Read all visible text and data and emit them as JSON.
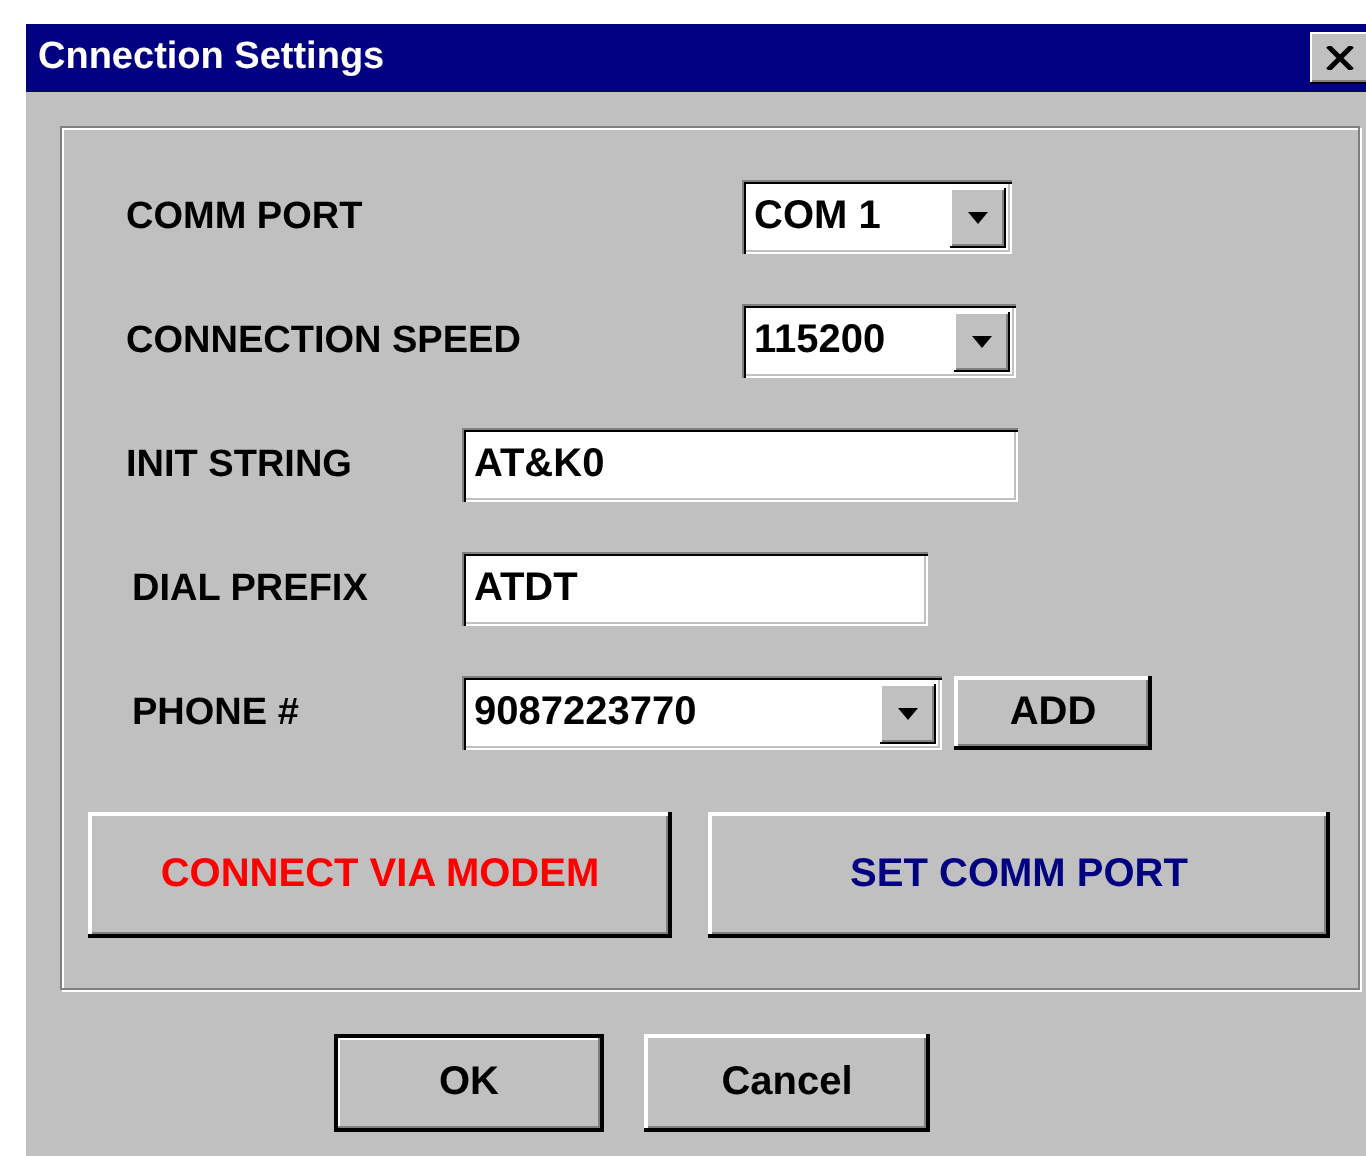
{
  "window": {
    "title": "Cnnection Settings"
  },
  "fields": [
    {
      "kind": "dropdown",
      "label": "COMM PORT",
      "value": "COM 1"
    },
    {
      "kind": "dropdown",
      "label": "CONNECTION SPEED",
      "value": "115200"
    },
    {
      "kind": "text",
      "label": "INIT STRING",
      "value": "AT&K0"
    },
    {
      "kind": "text",
      "label": "DIAL PREFIX",
      "value": "ATDT"
    },
    {
      "kind": "dropdown",
      "label": "PHONE #",
      "value": "9087223770",
      "button": "ADD"
    }
  ],
  "actions": [
    {
      "label": "CONNECT VIA MODEM",
      "color": "#ff0000"
    },
    {
      "label": "SET COMM PORT",
      "color": "#000080"
    }
  ],
  "buttons": [
    {
      "label": "OK",
      "default": true
    },
    {
      "label": "Cancel",
      "default": false
    }
  ]
}
